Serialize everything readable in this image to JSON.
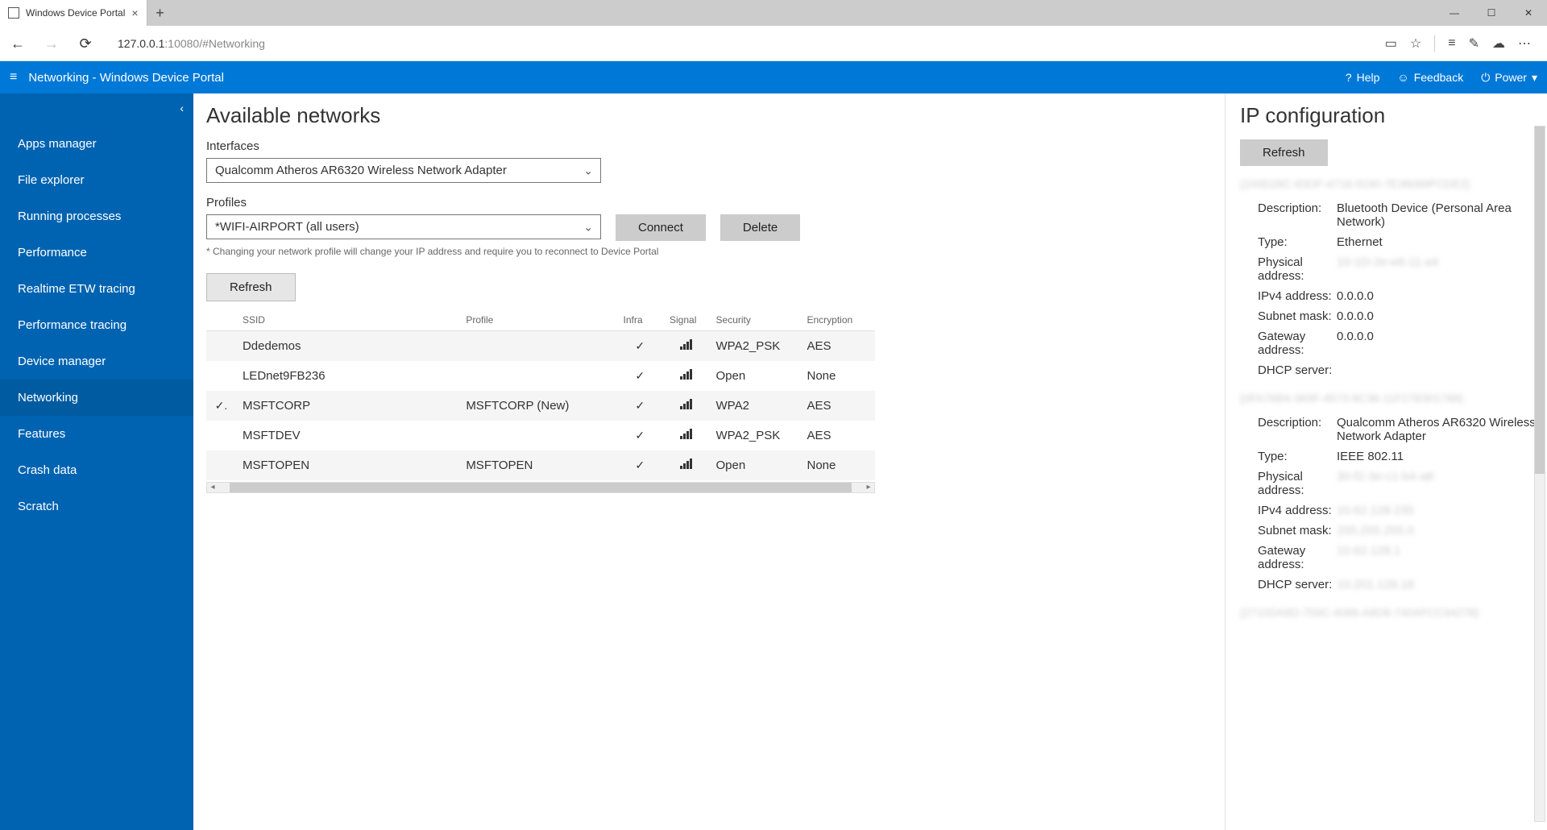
{
  "browser": {
    "tab_title": "Windows Device Portal",
    "url_host": "127.0.0.1",
    "url_rest": ":10080/#Networking"
  },
  "portal": {
    "title": "Networking - Windows Device Portal",
    "help": "Help",
    "feedback": "Feedback",
    "power": "Power"
  },
  "sidebar": {
    "items": [
      {
        "label": "Apps manager"
      },
      {
        "label": "File explorer"
      },
      {
        "label": "Running processes"
      },
      {
        "label": "Performance"
      },
      {
        "label": "Realtime ETW tracing"
      },
      {
        "label": "Performance tracing"
      },
      {
        "label": "Device manager"
      },
      {
        "label": "Networking"
      },
      {
        "label": "Features"
      },
      {
        "label": "Crash data"
      },
      {
        "label": "Scratch"
      }
    ],
    "active_index": 7
  },
  "main": {
    "title": "Available networks",
    "interfaces_label": "Interfaces",
    "interface_selected": "Qualcomm Atheros AR6320 Wireless Network Adapter",
    "profiles_label": "Profiles",
    "profile_selected": "*WIFI-AIRPORT (all users)",
    "connect": "Connect",
    "delete": "Delete",
    "hint": "* Changing your network profile will change your IP address and require you to reconnect to Device Portal",
    "refresh": "Refresh",
    "columns": {
      "ssid": "SSID",
      "profile": "Profile",
      "infra": "Infra",
      "signal": "Signal",
      "security": "Security",
      "encryption": "Encryption"
    },
    "rows": [
      {
        "connected": false,
        "ssid": "Ddedemos",
        "profile": "",
        "infra": true,
        "security": "WPA2_PSK",
        "encryption": "AES"
      },
      {
        "connected": false,
        "ssid": "LEDnet9FB236",
        "profile": "",
        "infra": true,
        "security": "Open",
        "encryption": "None"
      },
      {
        "connected": true,
        "ssid": "MSFTCORP",
        "profile": "MSFTCORP (New)",
        "infra": true,
        "security": "WPA2",
        "encryption": "AES"
      },
      {
        "connected": false,
        "ssid": "MSFTDEV",
        "profile": "",
        "infra": true,
        "security": "WPA2_PSK",
        "encryption": "AES"
      },
      {
        "connected": false,
        "ssid": "MSFTOPEN",
        "profile": "MSFTOPEN",
        "infra": true,
        "security": "Open",
        "encryption": "None"
      }
    ]
  },
  "ipconfig": {
    "title": "IP configuration",
    "refresh": "Refresh",
    "labels": {
      "desc": "Description:",
      "type": "Type:",
      "phys": "Physical address:",
      "ipv4": "IPv4 address:",
      "mask": "Subnet mask:",
      "gw": "Gateway address:",
      "dhcp": "DHCP server:"
    },
    "adapters": [
      {
        "id": "{100D28C-83DF-4718-9190-7E38089FCDE2}",
        "desc": "Bluetooth Device (Personal Area Network)",
        "type": "Ethernet",
        "phys": "10-1D-2e-e6-11-a4",
        "phys_blur": true,
        "ipv4": "0.0.0.0",
        "mask": "0.0.0.0",
        "gw": "0.0.0.0",
        "dhcp": ""
      },
      {
        "id": "{0FA76B4-383F-4573-8C36-11F27B301788}",
        "desc": "Qualcomm Atheros AR6320 Wireless Network Adapter",
        "type": "IEEE 802.11",
        "phys": "30-f2-3e-c1-b4-a8",
        "phys_blur": true,
        "ipv4": "10.62.128.235",
        "ipv4_blur": true,
        "mask": "255.255.255.0",
        "mask_blur": true,
        "gw": "10.62.128.1",
        "gw_blur": true,
        "dhcp": "10.201.128.18",
        "dhcp_blur": true
      }
    ],
    "trailing_id": "{2710DA8D-759C-4086-A8D6-740AFCC94278}"
  }
}
